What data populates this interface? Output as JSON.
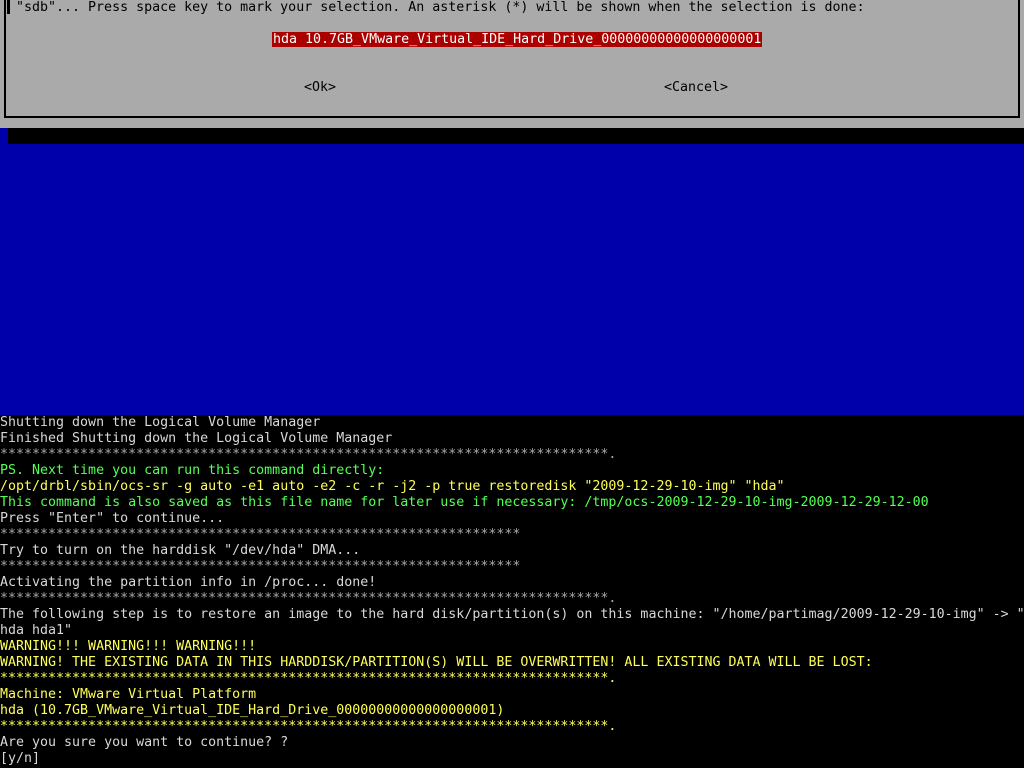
{
  "dialog": {
    "instruction": "\"sdb\"... Press space key to mark your selection. An asterisk (*) will be shown when the selection is done:",
    "options": [
      {
        "label": "hda 10.7GB_VMware_Virtual_IDE_Hard_Drive_00000000000000000001",
        "selected": true
      }
    ],
    "ok_label": "<Ok>",
    "cancel_label": "<Cancel>"
  },
  "colors": {
    "dialog_bg": "#aaaaaa",
    "backdrop": "#0000aa",
    "selection_bg": "#aa0000",
    "terminal_bg": "#000000",
    "text_green": "#55ff55",
    "text_yellow": "#ffff55",
    "text_white": "#d8d8d8"
  },
  "terminal": {
    "lines": [
      {
        "text": "Shutting down the Logical Volume Manager",
        "color": "white"
      },
      {
        "text": "Finished Shutting down the Logical Volume Manager",
        "color": "white"
      },
      {
        "text": "****************************************************************************.",
        "color": "gray"
      },
      {
        "text": "PS. Next time you can run this command directly:",
        "color": "green"
      },
      {
        "text": "/opt/drbl/sbin/ocs-sr -g auto -e1 auto -e2 -c -r -j2 -p true restoredisk \"2009-12-29-10-img\" \"hda\"",
        "color": "yellow"
      },
      {
        "text": "This command is also saved as this file name for later use if necessary: /tmp/ocs-2009-12-29-10-img-2009-12-29-12-00",
        "color": "green"
      },
      {
        "text": "Press \"Enter\" to continue...",
        "color": "white"
      },
      {
        "text": "*****************************************************************",
        "color": "gray"
      },
      {
        "text": "Try to turn on the harddisk \"/dev/hda\" DMA...",
        "color": "white"
      },
      {
        "text": "*****************************************************************",
        "color": "gray"
      },
      {
        "text": "Activating the partition info in /proc... done!",
        "color": "white"
      },
      {
        "text": "****************************************************************************.",
        "color": "gray"
      },
      {
        "text": "The following step is to restore an image to the hard disk/partition(s) on this machine: \"/home/partimag/2009-12-29-10-img\" -> \"",
        "color": "white"
      },
      {
        "text": "hda hda1\"",
        "color": "white"
      },
      {
        "text": "WARNING!!! WARNING!!! WARNING!!!",
        "color": "yellow"
      },
      {
        "text": "WARNING! THE EXISTING DATA IN THIS HARDDISK/PARTITION(S) WILL BE OVERWRITTEN! ALL EXISTING DATA WILL BE LOST:",
        "color": "yellow"
      },
      {
        "text": "****************************************************************************.",
        "color": "yellow"
      },
      {
        "text": "Machine: VMware Virtual Platform",
        "color": "yellow"
      },
      {
        "text": "hda (10.7GB_VMware_Virtual_IDE_Hard_Drive_00000000000000000001)",
        "color": "yellow"
      },
      {
        "text": "****************************************************************************.",
        "color": "yellow"
      },
      {
        "text": "Are you sure you want to continue? ?",
        "color": "white"
      },
      {
        "text": "[y/n]",
        "color": "white"
      }
    ]
  }
}
